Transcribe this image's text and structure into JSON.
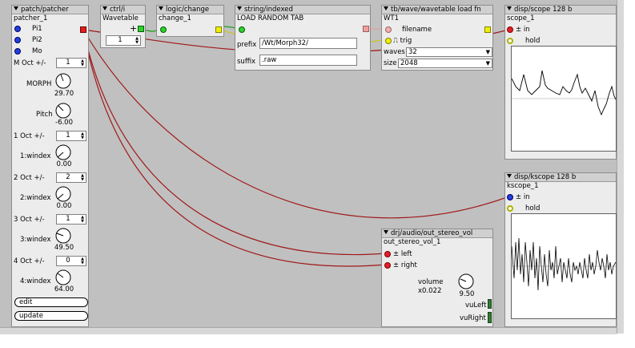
{
  "patcher": {
    "header": "patch/patcher",
    "instance": "patcher_1",
    "inlets": [
      {
        "label": "Pi1"
      },
      {
        "label": "Pi2"
      },
      {
        "label": "Mo"
      }
    ],
    "params": [
      {
        "label": "M Oct +/-",
        "value": "1",
        "knob_label": "MORPH",
        "knob_value": "29.70"
      },
      {
        "knob_label": "Pitch",
        "knob_value": "-6.00"
      },
      {
        "label": "1 Oct +/-",
        "value": "1",
        "knob_label": "1:windex",
        "knob_value": "0.00"
      },
      {
        "label": "2 Oct +/-",
        "value": "2",
        "knob_label": "2:windex",
        "knob_value": "0.00"
      },
      {
        "label": "3 Oct +/-",
        "value": "1",
        "knob_label": "3:windex",
        "knob_value": "49.50"
      },
      {
        "label": "4 Oct +/-",
        "value": "0",
        "knob_label": "4:windex",
        "knob_value": "64.00"
      }
    ],
    "buttons": {
      "edit": "edit",
      "update": "update"
    }
  },
  "ctrl": {
    "header": "ctrl/i",
    "instance": "Wavetable",
    "plus": "+",
    "value": "1"
  },
  "logic": {
    "header": "logic/change",
    "instance": "change_1"
  },
  "string": {
    "header": "string/indexed",
    "instance": "LOAD RANDOM TAB",
    "prefix_label": "prefix",
    "prefix_value": "/Wt/Morph32/",
    "suffix_label": "suffix",
    "suffix_value": ".raw"
  },
  "wtload": {
    "header": "tb/wave/wavetable load fn",
    "instance": "WT1",
    "filename": "filename",
    "trig": "trig",
    "waves_label": "waves",
    "waves_value": "32",
    "size_label": "size",
    "size_value": "2048"
  },
  "scope": {
    "header": "disp/scope 128 b",
    "instance": "scope_1",
    "in": "± in",
    "hold": "hold"
  },
  "kscope": {
    "header": "disp/kscope 128 b",
    "instance": "kscope_1",
    "in": "± in",
    "hold": "hold"
  },
  "out": {
    "header": "drj/audio/out_stereo_vol",
    "instance": "out_stereo_vol_1",
    "left": "± left",
    "right": "± right",
    "volume_label": "volume",
    "volume_sub": "x0.022",
    "volume_value": "9.50",
    "vuleft": "vuLeft",
    "vuright": "vuRight"
  },
  "colors": {
    "canvas": "#c0c0c0",
    "audio_wire": "#a01818",
    "bool_wire": "#c8c828",
    "int_wire": "#20a020"
  }
}
